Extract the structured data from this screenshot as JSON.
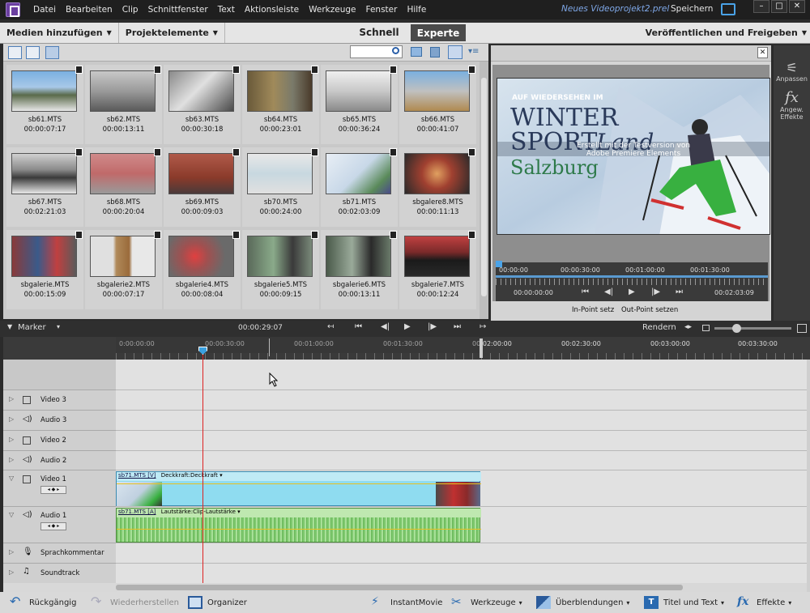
{
  "menubar": {
    "items": [
      "Datei",
      "Bearbeiten",
      "Clip",
      "Schnittfenster",
      "Text",
      "Aktionsleiste",
      "Werkzeuge",
      "Fenster",
      "Hilfe"
    ],
    "project_name": "Neues Videoprojekt2.prel",
    "save_label": "Speichern"
  },
  "header": {
    "add_media": "Medien hinzufügen",
    "project_assets": "Projektelemente",
    "mode_quick": "Schnell",
    "mode_expert": "Experte",
    "publish": "Veröffentlichen und Freigeben"
  },
  "clips": [
    {
      "name": "sb61.MTS",
      "duration": "00:00:07:17"
    },
    {
      "name": "sb62.MTS",
      "duration": "00:00:13:11"
    },
    {
      "name": "sb63.MTS",
      "duration": "00:00:30:18"
    },
    {
      "name": "sb64.MTS",
      "duration": "00:00:23:01"
    },
    {
      "name": "sb65.MTS",
      "duration": "00:00:36:24"
    },
    {
      "name": "sb66.MTS",
      "duration": "00:00:41:07"
    },
    {
      "name": "sb67.MTS",
      "duration": "00:02:21:03"
    },
    {
      "name": "sb68.MTS",
      "duration": "00:00:20:04"
    },
    {
      "name": "sb69.MTS",
      "duration": "00:00:09:03"
    },
    {
      "name": "sb70.MTS",
      "duration": "00:00:24:00"
    },
    {
      "name": "sb71.MTS",
      "duration": "00:02:03:09"
    },
    {
      "name": "sbgalere8.MTS",
      "duration": "00:00:11:13"
    },
    {
      "name": "sbgalerie.MTS",
      "duration": "00:00:15:09"
    },
    {
      "name": "sbgalerie2.MTS",
      "duration": "00:00:07:17"
    },
    {
      "name": "sbgalerie4.MTS",
      "duration": "00:00:08:04"
    },
    {
      "name": "sbgalerie5.MTS",
      "duration": "00:00:09:15"
    },
    {
      "name": "sbgalerie6.MTS",
      "duration": "00:00:13:11"
    },
    {
      "name": "sbgalerie7.MTS",
      "duration": "00:00:12:24"
    }
  ],
  "monitor": {
    "video_text": {
      "top": "AUF WIEDERSEHEN IM",
      "line1": "WINTER",
      "line2": "SPORT",
      "line2b": "Land",
      "city": "Salzburg",
      "watermark1": "Erstellt mit der Testversion von",
      "watermark2": "Adobe Premiere Elements"
    },
    "ruler_labels": [
      "00:00:00",
      "00:00:30:00",
      "00:01:00:00",
      "00:01:30:00"
    ],
    "current_time": "00:00:00:00",
    "total_time": "00:02:03:09",
    "in_point": "In-Point setz",
    "out_point": "Out-Point setzen"
  },
  "rightpanel": {
    "adjust": "Anpassen",
    "applied_effects": "Angew. Effekte",
    "fx": "fx"
  },
  "timeline": {
    "marker": "Marker",
    "timecode": "00:00:29:07",
    "render": "Rendern",
    "ruler_labels": [
      "0:00:00:00",
      "00:00:30:00",
      "00:01:00:00",
      "00:01:30:00",
      "00:02:00:00",
      "00:02:30:00",
      "00:03:00:00",
      "00:03:30:00"
    ],
    "tracks": [
      {
        "name": "Video 3"
      },
      {
        "name": "Audio 3"
      },
      {
        "name": "Video 2"
      },
      {
        "name": "Audio 2"
      },
      {
        "name": "Video 1"
      },
      {
        "name": "Audio 1"
      },
      {
        "name": "Sprachkommentar"
      },
      {
        "name": "Soundtrack"
      }
    ],
    "video_clip_label": "sb71.MTS [V]",
    "video_clip_fx": "Deckkraft:Deckkraft ▾",
    "audio_clip_label": "sb71.MTS [A]",
    "audio_clip_fx": "Lautstärke:Clip-Lautstärke ▾"
  },
  "bottombar": {
    "undo": "Rückgängig",
    "redo": "Wiederherstellen",
    "organizer": "Organizer",
    "instantmovie": "InstantMovie",
    "tools": "Werkzeuge",
    "transitions": "Überblendungen",
    "titles": "Titel und Text",
    "effects": "Effekte"
  },
  "colors": {
    "accent_blue": "#4aa3e8",
    "video_clip": "#8fdcf0",
    "audio_clip": "#9ed88e",
    "playhead": "#dd2222"
  }
}
